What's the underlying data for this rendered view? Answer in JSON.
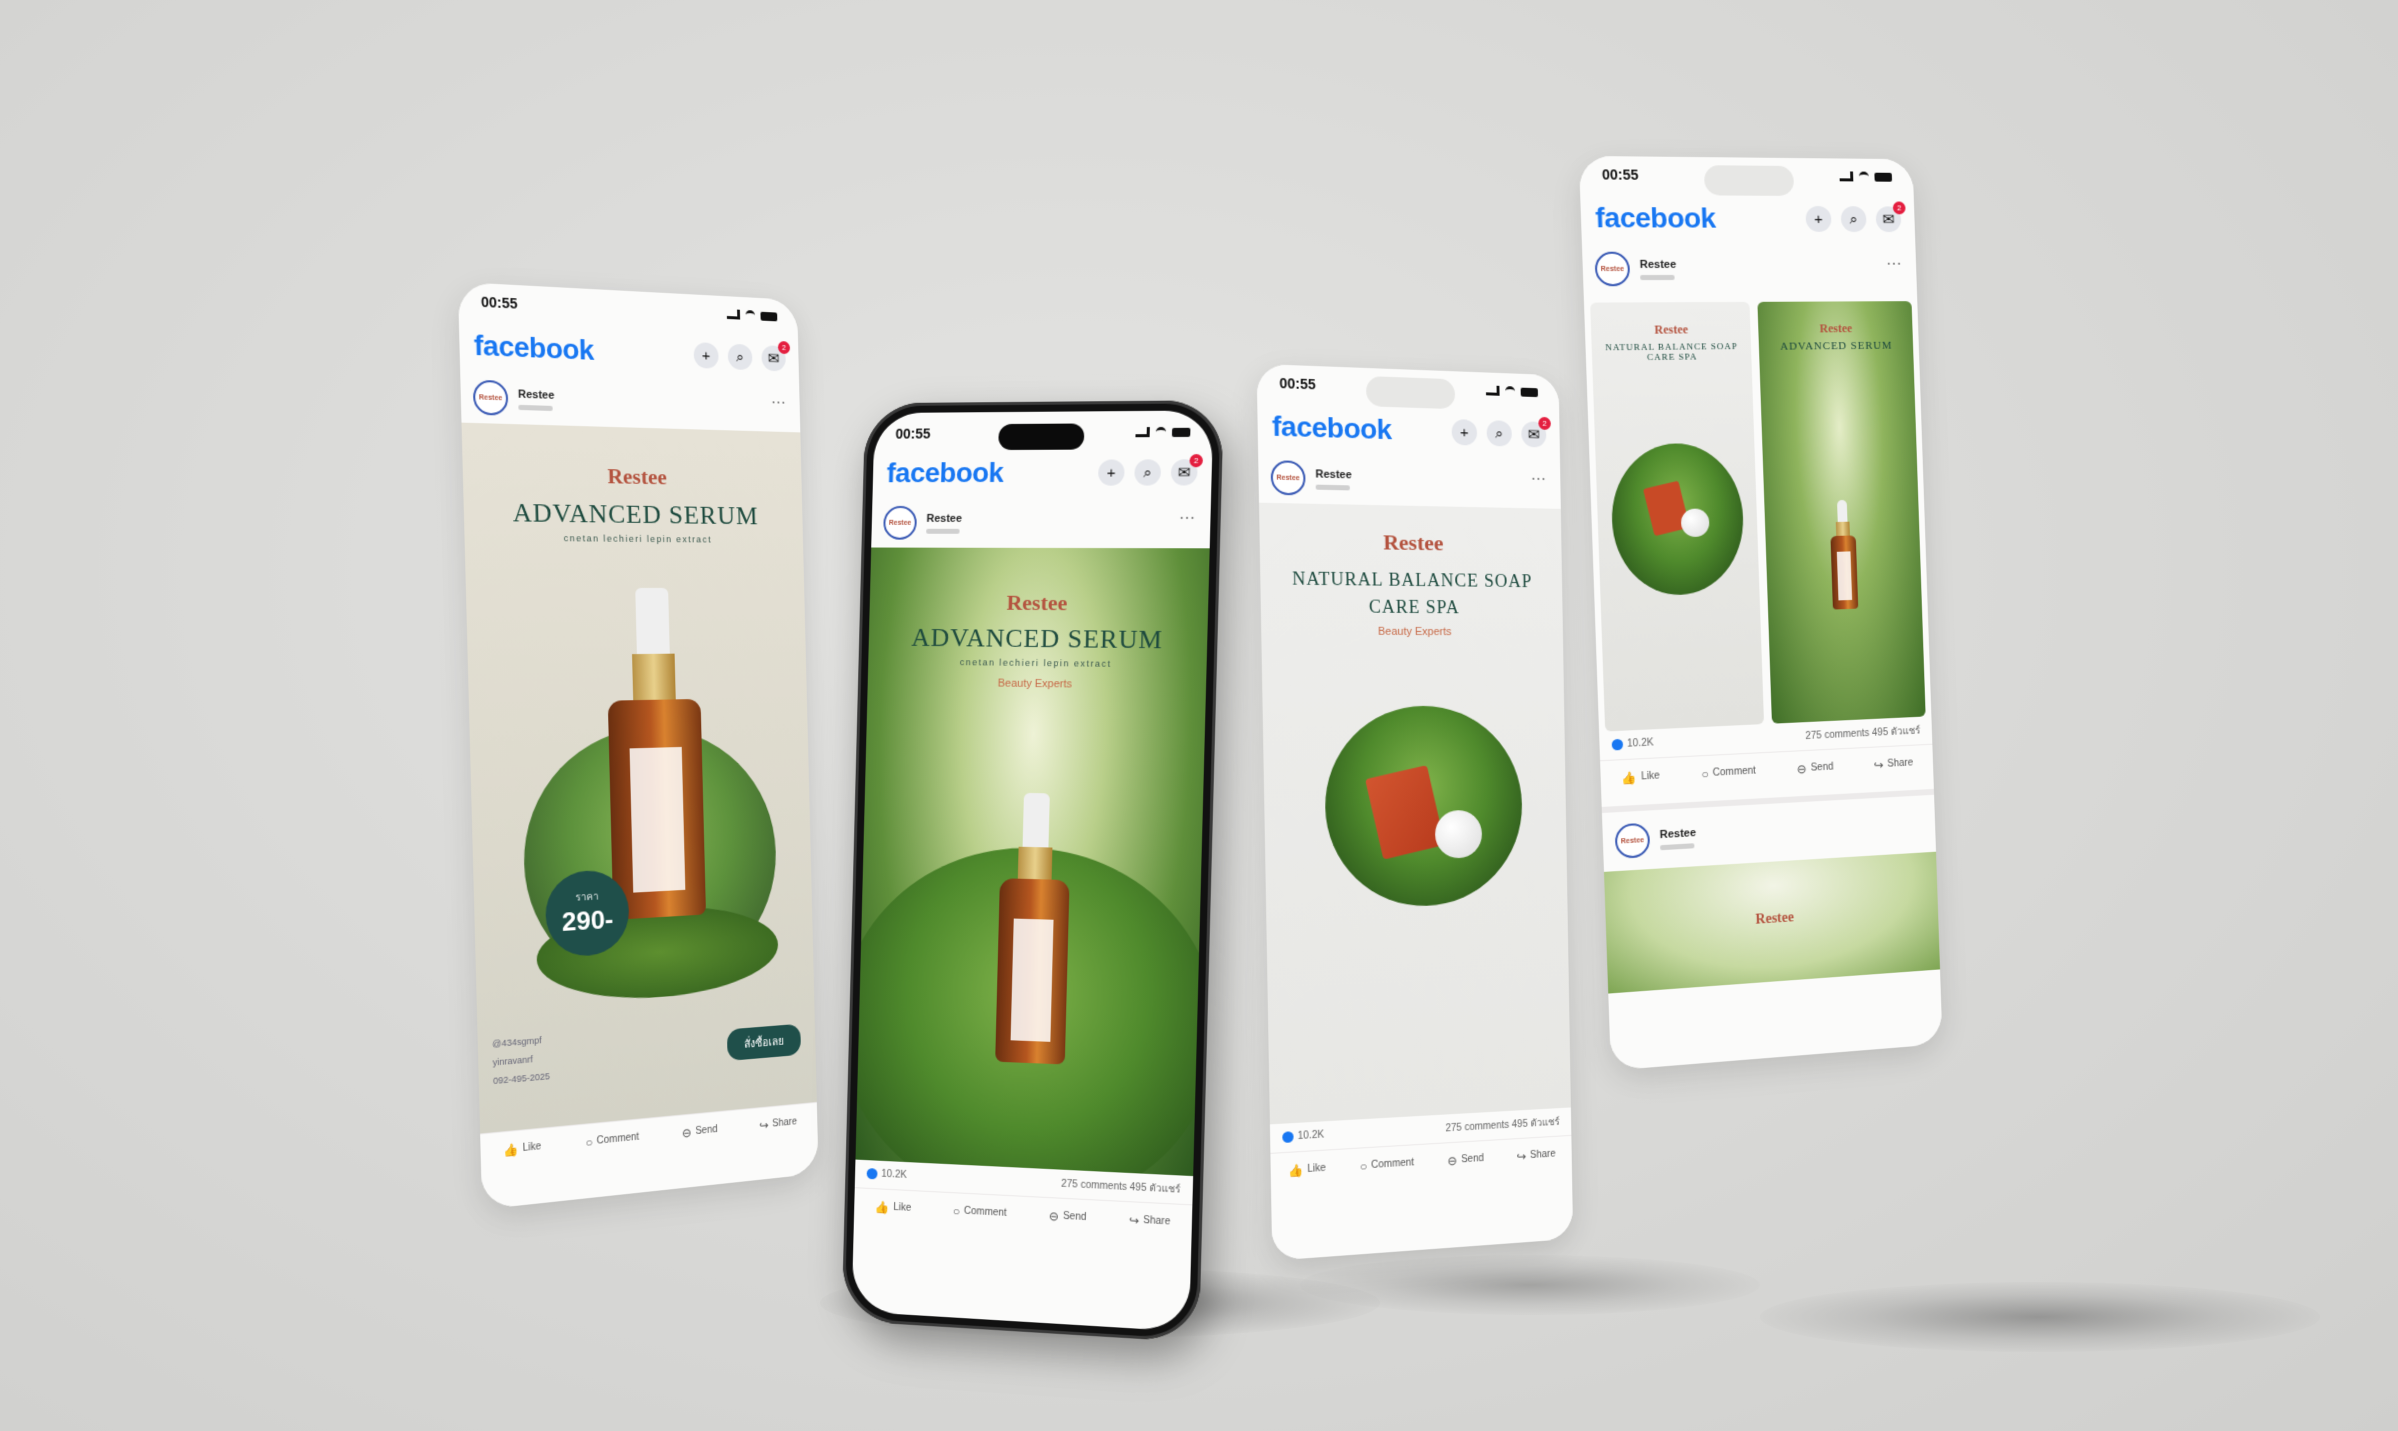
{
  "facebook": {
    "logo_text": "facebook",
    "add_icon": "plus-icon",
    "search_icon": "search-icon",
    "messenger_icon": "messenger-icon",
    "brand_color": "#1877f2"
  },
  "status": {
    "time": "00:55"
  },
  "page": {
    "name": "Restee",
    "avatar_text": "Restee"
  },
  "post_stats": {
    "likes": "10.2K",
    "comments": "275 comments",
    "shares": "495 ตัวแชร์"
  },
  "actions": {
    "like": "Like",
    "comment": "Comment",
    "send": "Send",
    "share": "Share"
  },
  "ads": {
    "serum_1": {
      "brand": "Restee",
      "title": "ADVANCED SERUM",
      "subtitle": "cnetan lechieri lepin extract",
      "price_label": "ราคา",
      "price": "290-",
      "contact_line": "@434sgmpf",
      "contact_fb": "yinravanrf",
      "contact_phone": "092-495-2025",
      "cta": "สั่งซื้อเลย"
    },
    "serum_2": {
      "brand": "Restee",
      "title": "ADVANCED SERUM",
      "subtitle": "cnetan lechieri lepin extract",
      "tagline": "Beauty Experts"
    },
    "soap": {
      "brand": "Restee",
      "title_line1": "NATURAL BALANCE SOAP",
      "title_line2": "CARE SPA",
      "tagline": "Beauty Experts"
    },
    "carousel": {
      "card_1_brand": "Restee",
      "card_1_title": "NATURAL BALANCE SOAP CARE SPA",
      "card_2_brand": "Restee",
      "card_2_title": "ADVANCED SERUM",
      "footer_brand": "Restee"
    }
  }
}
